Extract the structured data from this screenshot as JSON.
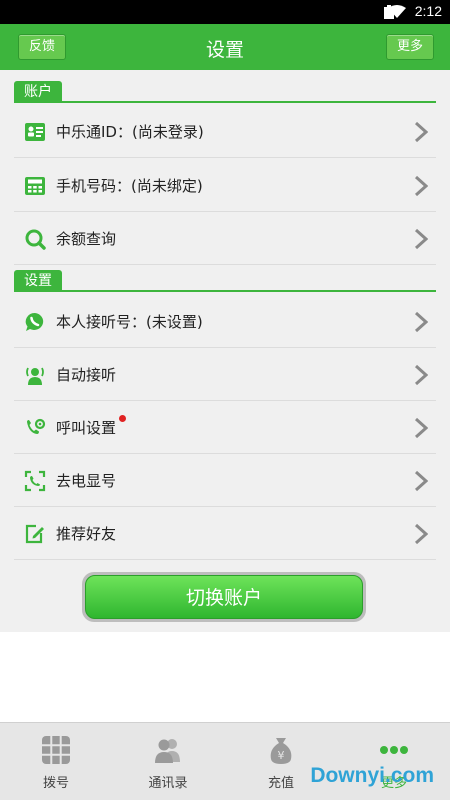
{
  "status_bar": {
    "time": "2:12"
  },
  "header": {
    "title": "设置",
    "left_button": "反馈",
    "right_button": "更多"
  },
  "account_section": {
    "title": "账户",
    "items": [
      {
        "label": "中乐通ID：(尚未登录)",
        "icon": "id-card-icon"
      },
      {
        "label": "手机号码：(尚未绑定)",
        "icon": "phone-keypad-icon"
      },
      {
        "label": "余额查询",
        "icon": "search-icon"
      }
    ]
  },
  "settings_section": {
    "title": "设置",
    "items": [
      {
        "label": "本人接听号：(未设置)",
        "icon": "chat-bubble-icon"
      },
      {
        "label": "自动接听",
        "icon": "auto-answer-icon"
      },
      {
        "label": "呼叫设置",
        "icon": "call-settings-icon",
        "badge": "red-dot"
      },
      {
        "label": "去电显号",
        "icon": "caller-id-icon"
      },
      {
        "label": "推荐好友",
        "icon": "edit-icon"
      }
    ]
  },
  "switch_button": "切换账户",
  "tab_bar": [
    {
      "label": "拨号",
      "icon": "dialpad-icon"
    },
    {
      "label": "通讯录",
      "icon": "contacts-icon"
    },
    {
      "label": "充值",
      "icon": "money-bag-icon"
    },
    {
      "label": "更多",
      "icon": "more-dots-icon",
      "active": true
    }
  ],
  "watermark": "Downyi.com",
  "colors": {
    "accent": "#3db53d",
    "background": "#f0f0f0",
    "tab_bar": "#e6e6e6",
    "badge": "#e02222"
  }
}
